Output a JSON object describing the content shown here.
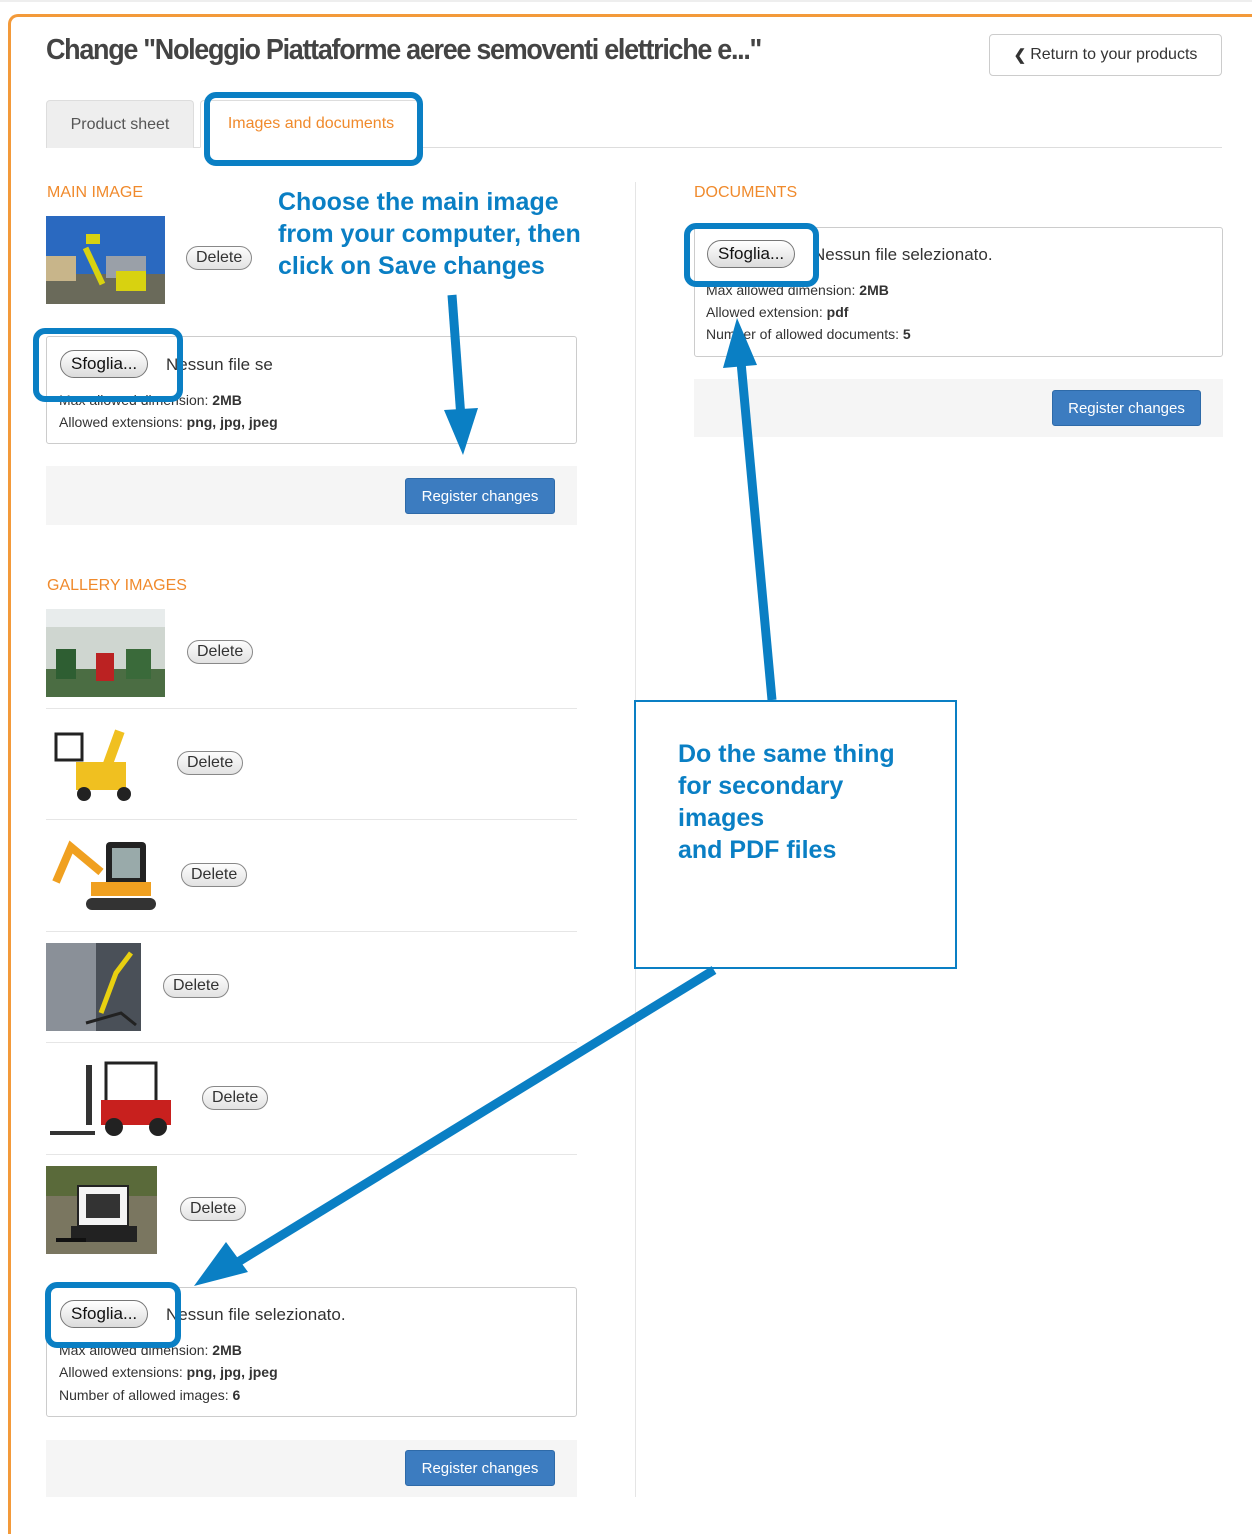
{
  "header": {
    "title": "Change \"Noleggio Piattaforme aeree semoventi elettriche e...\"",
    "return_label": "Return to your products"
  },
  "tabs": [
    {
      "label": "Product sheet",
      "active": false
    },
    {
      "label": "Images and documents",
      "active": true
    }
  ],
  "main_image": {
    "section_title": "MAIN IMAGE",
    "delete_label": "Delete",
    "upload": {
      "browse_label": "Sfoglia...",
      "no_file_text": "Nessun file se",
      "max_dimension_label": "Max allowed dimension: ",
      "max_dimension_value": "2MB",
      "extensions_label": "Allowed extensions: ",
      "extensions_value": "png, jpg, jpeg"
    },
    "register_label": "Register changes"
  },
  "gallery": {
    "section_title": "GALLERY IMAGES",
    "items": [
      {
        "delete_label": "Delete"
      },
      {
        "delete_label": "Delete"
      },
      {
        "delete_label": "Delete"
      },
      {
        "delete_label": "Delete"
      },
      {
        "delete_label": "Delete"
      },
      {
        "delete_label": "Delete"
      }
    ],
    "upload": {
      "browse_label": "Sfoglia...",
      "no_file_text": "Nessun file selezionato.",
      "max_dimension_label": "Max allowed dimension: ",
      "max_dimension_value": "2MB",
      "extensions_label": "Allowed extensions: ",
      "extensions_value": "png, jpg, jpeg",
      "count_label": "Number of allowed images: ",
      "count_value": "6"
    },
    "register_label": "Register changes"
  },
  "documents": {
    "section_title": "DOCUMENTS",
    "upload": {
      "browse_label": "Sfoglia...",
      "no_file_text": "Nessun file selezionato.",
      "max_dimension_label": "Max allowed dimension: ",
      "max_dimension_value": "2MB",
      "extension_label": "Allowed extension: ",
      "extension_value": "pdf",
      "count_label": "Number of allowed documents: ",
      "count_value": "5"
    },
    "register_label": "Register changes"
  },
  "annotations": {
    "callout_1": [
      "Choose the main image",
      "from your computer, then",
      "click on Save changes"
    ],
    "callout_2": [
      "Do the same thing",
      "for secondary",
      "images",
      "and PDF files"
    ],
    "color": "#0a7fc4"
  },
  "colors": {
    "accent_orange": "#f08a2c",
    "button_blue": "#3c7cc0",
    "annotation_blue": "#0a7fc4"
  }
}
